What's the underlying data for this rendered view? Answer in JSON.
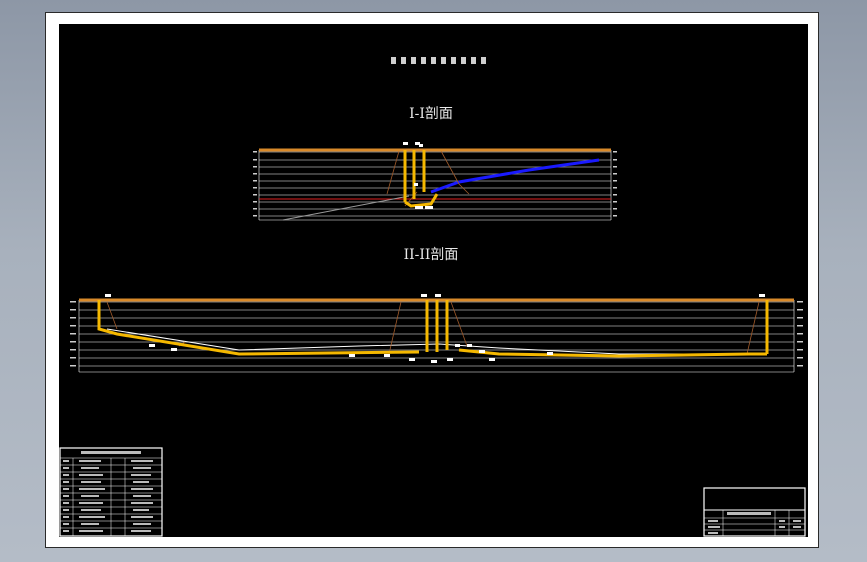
{
  "drawing": {
    "main_title": "",
    "section_1_label": "I-I剖面",
    "section_2_label": "II-II剖面"
  },
  "colors": {
    "background": "#000000",
    "paper": "#ffffff",
    "ground_line": "#d98a2a",
    "pipeline": "#f5b800",
    "grid_line": "#ffffff",
    "blue_line": "#1a1aff",
    "red_line": "#e02020",
    "terrain_line": "#a05a2a"
  },
  "legend_table": {
    "title": "",
    "rows": 11
  },
  "title_block": {
    "sheet_name": ""
  }
}
